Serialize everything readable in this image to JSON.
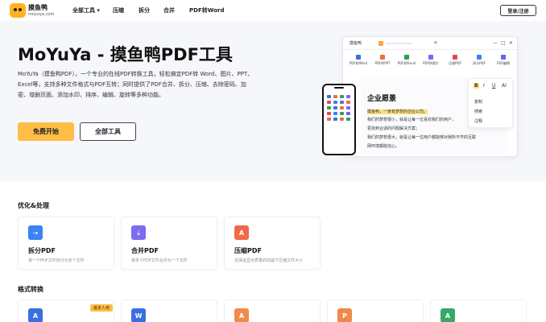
{
  "header": {
    "brand": "摸鱼鸭",
    "brand_sub": "moyuya.com",
    "nav": [
      "全部工具 ▾",
      "压缩",
      "拆分",
      "合并",
      "PDF转Word"
    ],
    "login": "登录/注册"
  },
  "hero": {
    "title": "MoYuYa - 摸鱼鸭PDF工具",
    "description": "MoYuYa（摸鱼鸭PDF），一个专业的在线PDF转换工具，轻松搞定PDF转 Word、图片、PPT、Excel等，支持多种文件格式与PDF互转；同时提供了PDF合并、拆分、压缩、去除密码、加密、增删页面、添加水印、排序、编辑、旋转等多种功能。",
    "primary_button": "免费开始",
    "secondary_button": "全部工具"
  },
  "mockup": {
    "tab": "摸鱼鸭",
    "plus": "+",
    "controls": [
      "—",
      "□",
      "✕"
    ],
    "tools": [
      {
        "label": "PDF转Word",
        "icon": "word-icon",
        "color": "#3b6fe0"
      },
      {
        "label": "PDF转PPT",
        "icon": "ppt-icon",
        "color": "#e8703a"
      },
      {
        "label": "PDF转Excel",
        "icon": "excel-icon",
        "color": "#2f9e5a"
      },
      {
        "label": "PDF转图片",
        "icon": "image-icon",
        "color": "#8b5cf6"
      },
      {
        "label": "压缩PDF",
        "icon": "compress-icon",
        "color": "#e24a4a"
      },
      {
        "label": "拆分PDF",
        "icon": "split-icon",
        "color": "#3b82f6"
      },
      {
        "label": "PDF编辑",
        "icon": "edit-icon",
        "color": "#6366f1"
      }
    ],
    "doc_title": "企业愿景",
    "doc_lines": [
      "摸鱼鸭，一家有梦想的创业公司。",
      "我们的梦想很小，就是让每一位喜欢我们的用户，",
      "更找到合适的问题解决方案；",
      "我们的梦想很大，就是让每一位用户都能够对我所不齐的互联",
      "网环境都能信心。"
    ],
    "popup_format": [
      "B",
      "I",
      "U",
      "AI"
    ],
    "popup_items": [
      "复制",
      "搜索",
      "注释"
    ]
  },
  "sections": {
    "optimize_title": "优化&处理",
    "format_title": "格式转换",
    "badge": "最多人用"
  },
  "cards": [
    {
      "title": "拆分PDF",
      "desc": "将一个PDF文件拆分为多个文件",
      "icon": "split-pdf-icon",
      "color": "#3b82f6"
    },
    {
      "title": "合并PDF",
      "desc": "将多个PDF文件合并为一个文件",
      "icon": "merge-pdf-icon",
      "color": "#7c6cf0"
    },
    {
      "title": "压缩PDF",
      "desc": "在保证显示质量的前提下压缩文件大小",
      "icon": "compress-pdf-icon",
      "color": "#f06a4a"
    }
  ],
  "format_cards": [
    {
      "icon": "word-icon",
      "color": "#3b6fe0"
    },
    {
      "icon": "word-icon",
      "color": "#3b6fe0"
    },
    {
      "icon": "ppt-icon",
      "color": "#f08a4a"
    },
    {
      "icon": "ppt-icon",
      "color": "#f08a4a"
    },
    {
      "icon": "excel-icon",
      "color": "#36a86a"
    }
  ]
}
